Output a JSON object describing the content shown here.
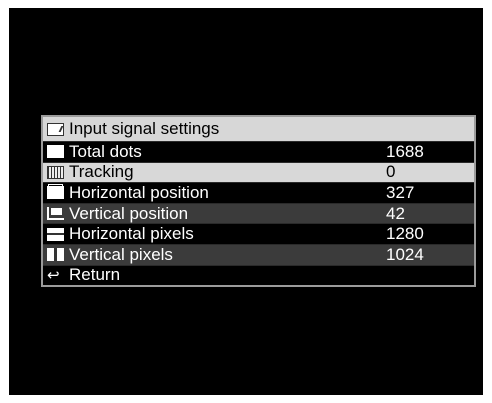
{
  "menu": {
    "title": "Input signal settings",
    "header_icon": "input-signal-icon",
    "items": [
      {
        "label": "Total dots",
        "value": "1688",
        "icon": "total-dots-icon"
      },
      {
        "label": "Tracking",
        "value": "0",
        "icon": "tracking-icon",
        "selected": true
      },
      {
        "label": "Horizontal position",
        "value": "327",
        "icon": "horizontal-position-icon"
      },
      {
        "label": "Vertical position",
        "value": "42",
        "icon": "vertical-position-icon"
      },
      {
        "label": "Horizontal pixels",
        "value": "1280",
        "icon": "horizontal-pixels-icon"
      },
      {
        "label": "Vertical pixels",
        "value": "1024",
        "icon": "vertical-pixels-icon"
      },
      {
        "label": "Return",
        "value": "",
        "icon": "return-icon"
      }
    ]
  },
  "colors": {
    "screen_bg": "#000000",
    "header_bg": "#d7d7d7",
    "selected_bg": "#d8d8d8",
    "alt_row_bg": "#3b3b3b",
    "border": "#9b9b9b"
  }
}
